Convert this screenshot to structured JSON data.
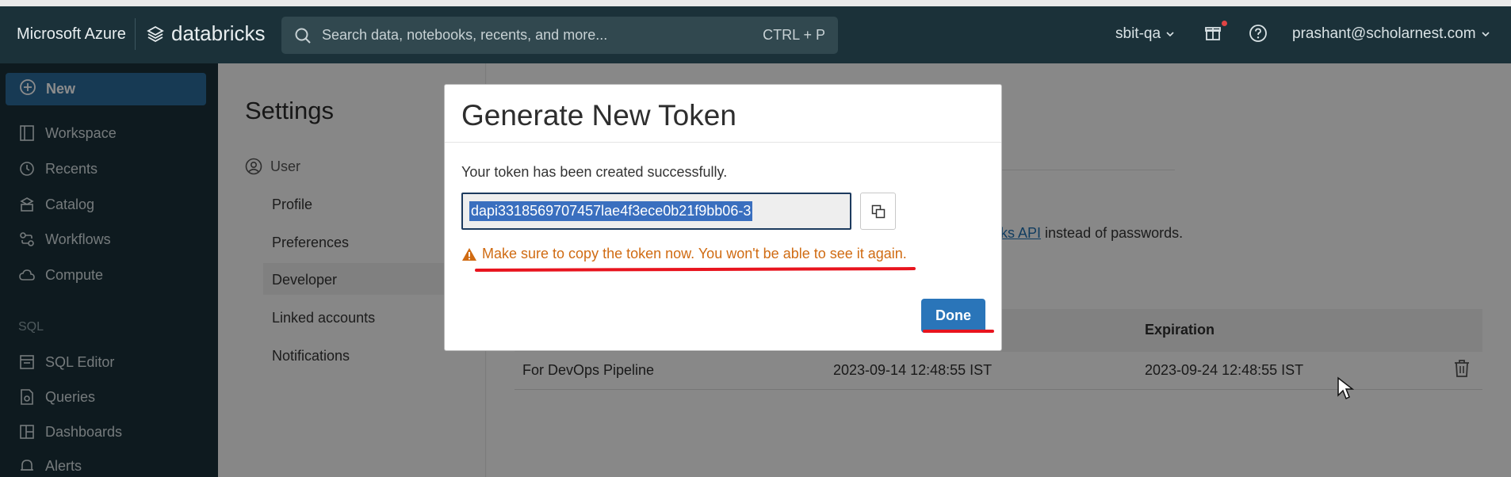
{
  "header": {
    "azure_label": "Microsoft Azure",
    "databricks_label": "databricks",
    "search_placeholder": "Search data, notebooks, recents, and more...",
    "search_shortcut": "CTRL + P",
    "workspace": "sbit-qa",
    "user_email": "prashant@scholarnest.com"
  },
  "sidebar": {
    "new_label": "New",
    "items": [
      {
        "label": "Workspace",
        "icon": "workspace-icon"
      },
      {
        "label": "Recents",
        "icon": "clock-icon"
      },
      {
        "label": "Catalog",
        "icon": "catalog-icon"
      },
      {
        "label": "Workflows",
        "icon": "workflows-icon"
      },
      {
        "label": "Compute",
        "icon": "cloud-icon"
      }
    ],
    "sql_section": "SQL",
    "sql_items": [
      {
        "label": "SQL Editor",
        "icon": "sql-editor-icon"
      },
      {
        "label": "Queries",
        "icon": "queries-icon"
      },
      {
        "label": "Dashboards",
        "icon": "dashboards-icon"
      },
      {
        "label": "Alerts",
        "icon": "bell-icon"
      }
    ]
  },
  "settings": {
    "title": "Settings",
    "user_group": "User",
    "nav": [
      "Profile",
      "Preferences",
      "Developer",
      "Linked accounts",
      "Notifications"
    ]
  },
  "main": {
    "api_link_text": "ks API",
    "api_suffix": " instead of passwords.",
    "table": {
      "expiration_header": "Expiration",
      "row": {
        "comment": "For DevOps Pipeline",
        "created": "2023-09-14 12:48:55 IST",
        "expiration": "2023-09-24 12:48:55 IST"
      }
    }
  },
  "modal": {
    "title": "Generate New Token",
    "message": "Your token has been created successfully.",
    "token": "dapi3318569707457lae4f3ece0b21f9bb06-3",
    "warning": "Make sure to copy the token now. You won't be able to see it again.",
    "done_label": "Done"
  },
  "colors": {
    "header_bg": "#1b3139",
    "accent": "#2a75b9",
    "warning": "#d06b12",
    "annotation": "#e8141e"
  }
}
